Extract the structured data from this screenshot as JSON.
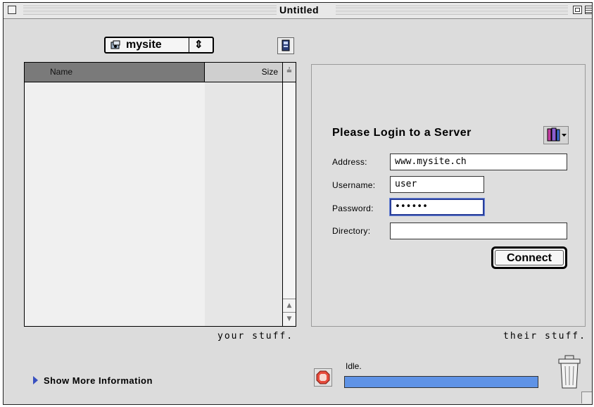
{
  "window": {
    "title": "Untitled"
  },
  "site_selector": {
    "icon": "mysite-icon",
    "selected": "mysite",
    "arrows": "⇕"
  },
  "file_list": {
    "columns": [
      {
        "label": "Name"
      },
      {
        "label": "Size"
      }
    ],
    "sort_glyph": "≟",
    "scroll_up": "▲",
    "scroll_down": "▼",
    "rows": []
  },
  "captions": {
    "local": "your stuff.",
    "remote": "their stuff."
  },
  "login": {
    "title": "Please Login to a Server",
    "address_label": "Address:",
    "address_value": "www.mysite.ch",
    "username_label": "Username:",
    "username_value": "user",
    "password_label": "Password:",
    "password_value": "••••••",
    "directory_label": "Directory:",
    "directory_value": "",
    "connect_label": "Connect"
  },
  "footer": {
    "show_more": "Show More Information",
    "status": "Idle.",
    "progress": 1.0
  },
  "colors": {
    "progress": "#5f93e6",
    "focus": "#2a3f9a",
    "disclosure": "#3850c0"
  }
}
